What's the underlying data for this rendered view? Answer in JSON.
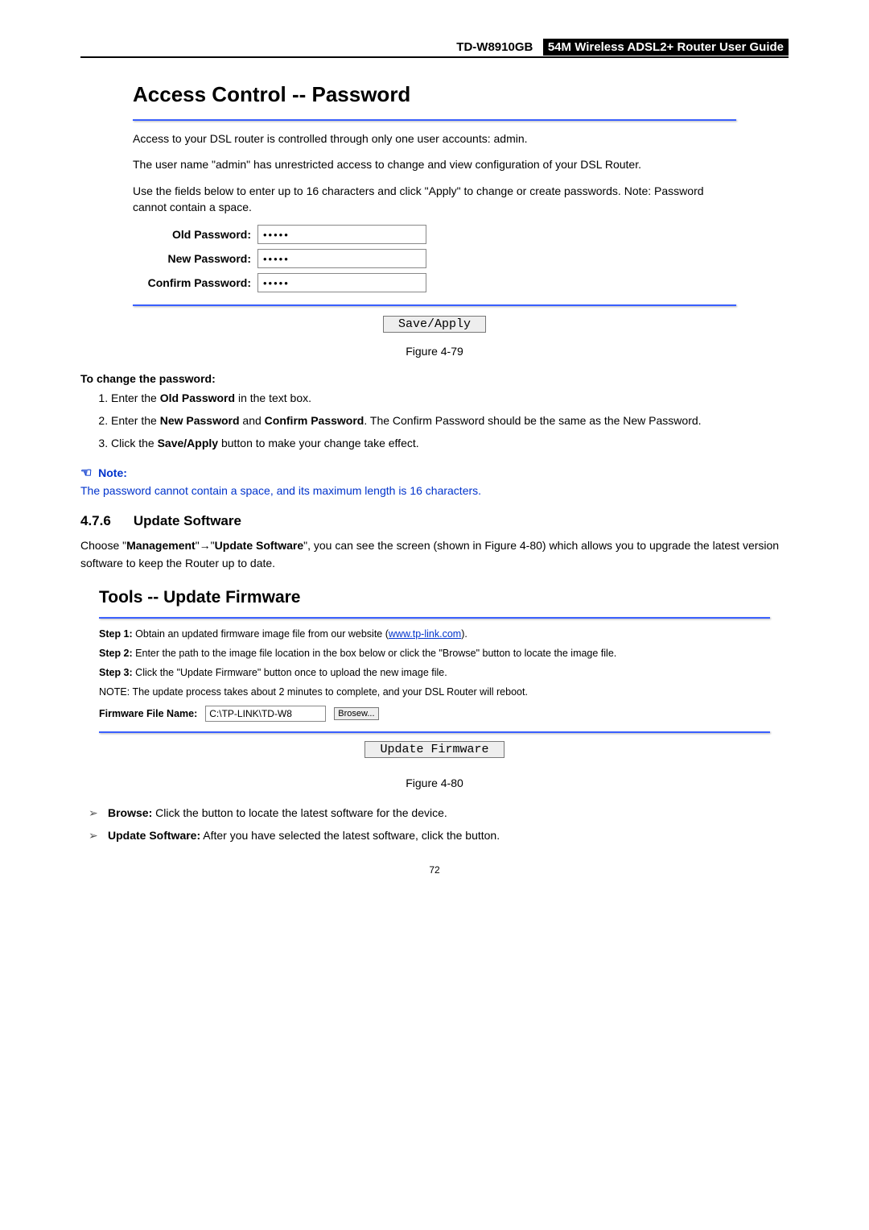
{
  "header": {
    "model": "TD-W8910GB",
    "title": "54M  Wireless  ADSL2+  Router  User  Guide"
  },
  "fig79": {
    "heading": "Access Control -- Password",
    "p1": "Access to your DSL router is controlled through only one user accounts: admin.",
    "p2": "The user name \"admin\" has unrestricted access to change and view configuration of your DSL Router.",
    "p3": "Use the fields below to enter up to 16 characters and click \"Apply\" to change or create passwords. Note: Password cannot contain a space.",
    "labels": {
      "old": "Old Password:",
      "new": "New Password:",
      "confirm": "Confirm Password:"
    },
    "values": {
      "old": "•••••",
      "new": "•••••",
      "confirm": "•••••"
    },
    "button": "Save/Apply",
    "caption": "Figure 4-79"
  },
  "changepw": {
    "heading": "To change the password:",
    "steps": {
      "s1_pre": "Enter the ",
      "s1_b": "Old Password",
      "s1_post": " in the text box.",
      "s2_pre": "Enter  the  ",
      "s2_b1": "New  Password",
      "s2_mid": "  and  ",
      "s2_b2": "Confirm  Password",
      "s2_post": ".  The  Confirm  Password  should  be  the same as the New Password.",
      "s3_pre": "Click the ",
      "s3_b": "Save/Apply",
      "s3_post": " button to make your change take effect."
    }
  },
  "note": {
    "label": "Note:",
    "body": "The password cannot contain a space, and its maximum length is 16 characters."
  },
  "sect": {
    "num": "4.7.6",
    "title": "Update Software",
    "intro_pre": "Choose \"",
    "intro_b1": "Management",
    "intro_arrow": "\"→\"",
    "intro_b2": "Update Software",
    "intro_mid": "\", you can see the screen (shown in ",
    "intro_link": "Figure 4-80",
    "intro_post": ") which allows you to upgrade the latest version software to keep the Router up to date."
  },
  "fig80": {
    "heading": "Tools -- Update Firmware",
    "step1_b": "Step 1:",
    "step1_t": " Obtain an updated firmware image file from our website (",
    "step1_link": "www.tp-link.com",
    "step1_end": ").",
    "step2_b": "Step 2:",
    "step2_t": " Enter the path to the image file location in the box below or click the \"Browse\" button to locate the image file.",
    "step3_b": "Step 3:",
    "step3_t": " Click the \"Update Firmware\" button once to upload the new image file.",
    "noteline": "NOTE: The update process takes about 2 minutes to complete, and your DSL Router will reboot.",
    "ffn_label": "Firmware File Name:",
    "ffn_value": "C:\\TP-LINK\\TD-W8",
    "browse": "Brosew...",
    "button": "Update Firmware",
    "caption": "Figure 4-80"
  },
  "bullets": {
    "b1_b": "Browse:",
    "b1_t": " Click the button to locate the latest software for the device.",
    "b2_b": "Update Software:",
    "b2_t": " After you have selected the latest software, click the button."
  },
  "pagenum": "72"
}
